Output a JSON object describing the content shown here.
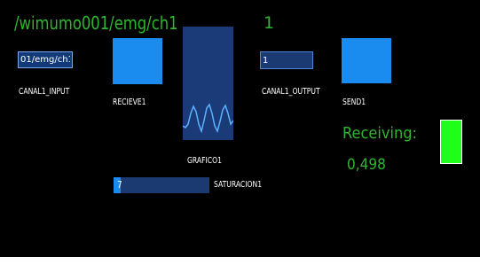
{
  "header": {
    "path": "/wimumo001/emg/ch1",
    "output_number": "1"
  },
  "inputs": {
    "canal_input": {
      "value": "01/emg/ch1",
      "label": "CANAL1_INPUT"
    },
    "canal_output": {
      "value": "1",
      "label": "CANAL1_OUTPUT"
    }
  },
  "indicators": {
    "recieve_label": "RECIEVE1",
    "send_label": "SEND1",
    "graph_label": "GRAFICO1",
    "status_color": "#20ff1a",
    "led_color": "#1a8cf0"
  },
  "saturation": {
    "value": "7",
    "label": "SATURACION1",
    "level_fraction": 0.07
  },
  "receiving": {
    "label": "Receiving:",
    "value": "0,498"
  }
}
